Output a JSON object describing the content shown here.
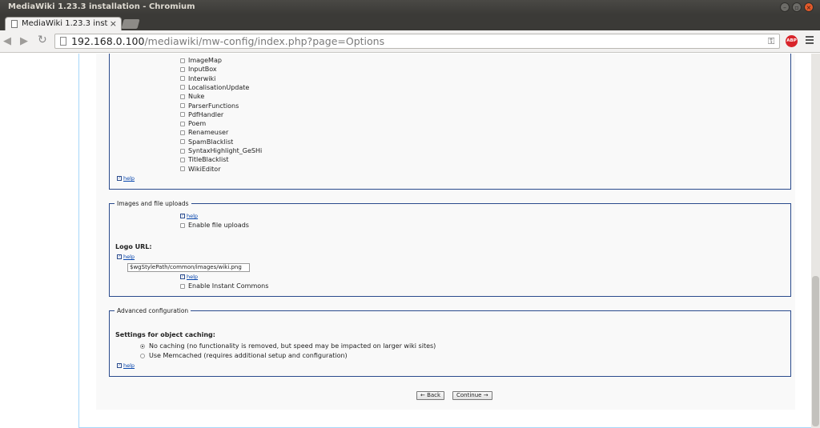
{
  "window": {
    "title": "MediaWiki 1.23.3 installation - Chromium"
  },
  "tab": {
    "label": "MediaWiki 1.23.3 inst",
    "close": "×"
  },
  "toolbar": {
    "url_host": "192.168.0.100",
    "url_rest": "/mediawiki/mw-config/index.php?page=Options",
    "abp_label": "ABP"
  },
  "extensions": {
    "items": [
      "ImageMap",
      "InputBox",
      "Interwiki",
      "LocalisationUpdate",
      "Nuke",
      "ParserFunctions",
      "PdfHandler",
      "Poem",
      "Renameuser",
      "SpamBlacklist",
      "SyntaxHighlight_GeSHi",
      "TitleBlacklist",
      "WikiEditor"
    ],
    "help": "help"
  },
  "images": {
    "legend": "Images and file uploads",
    "help": "help",
    "enable_uploads": "Enable file uploads",
    "logo_label": "Logo URL:",
    "logo_help": "help",
    "logo_value": "$wgStylePath/common/images/wiki.png",
    "instant_help": "help",
    "instant_commons": "Enable Instant Commons"
  },
  "advanced": {
    "legend": "Advanced configuration",
    "caching_label": "Settings for object caching:",
    "no_caching": "No caching (no functionality is removed, but speed may be impacted on larger wiki sites)",
    "memcached": "Use Memcached (requires additional setup and configuration)",
    "help": "help"
  },
  "buttons": {
    "back": "← Back",
    "continue": "Continue →"
  }
}
